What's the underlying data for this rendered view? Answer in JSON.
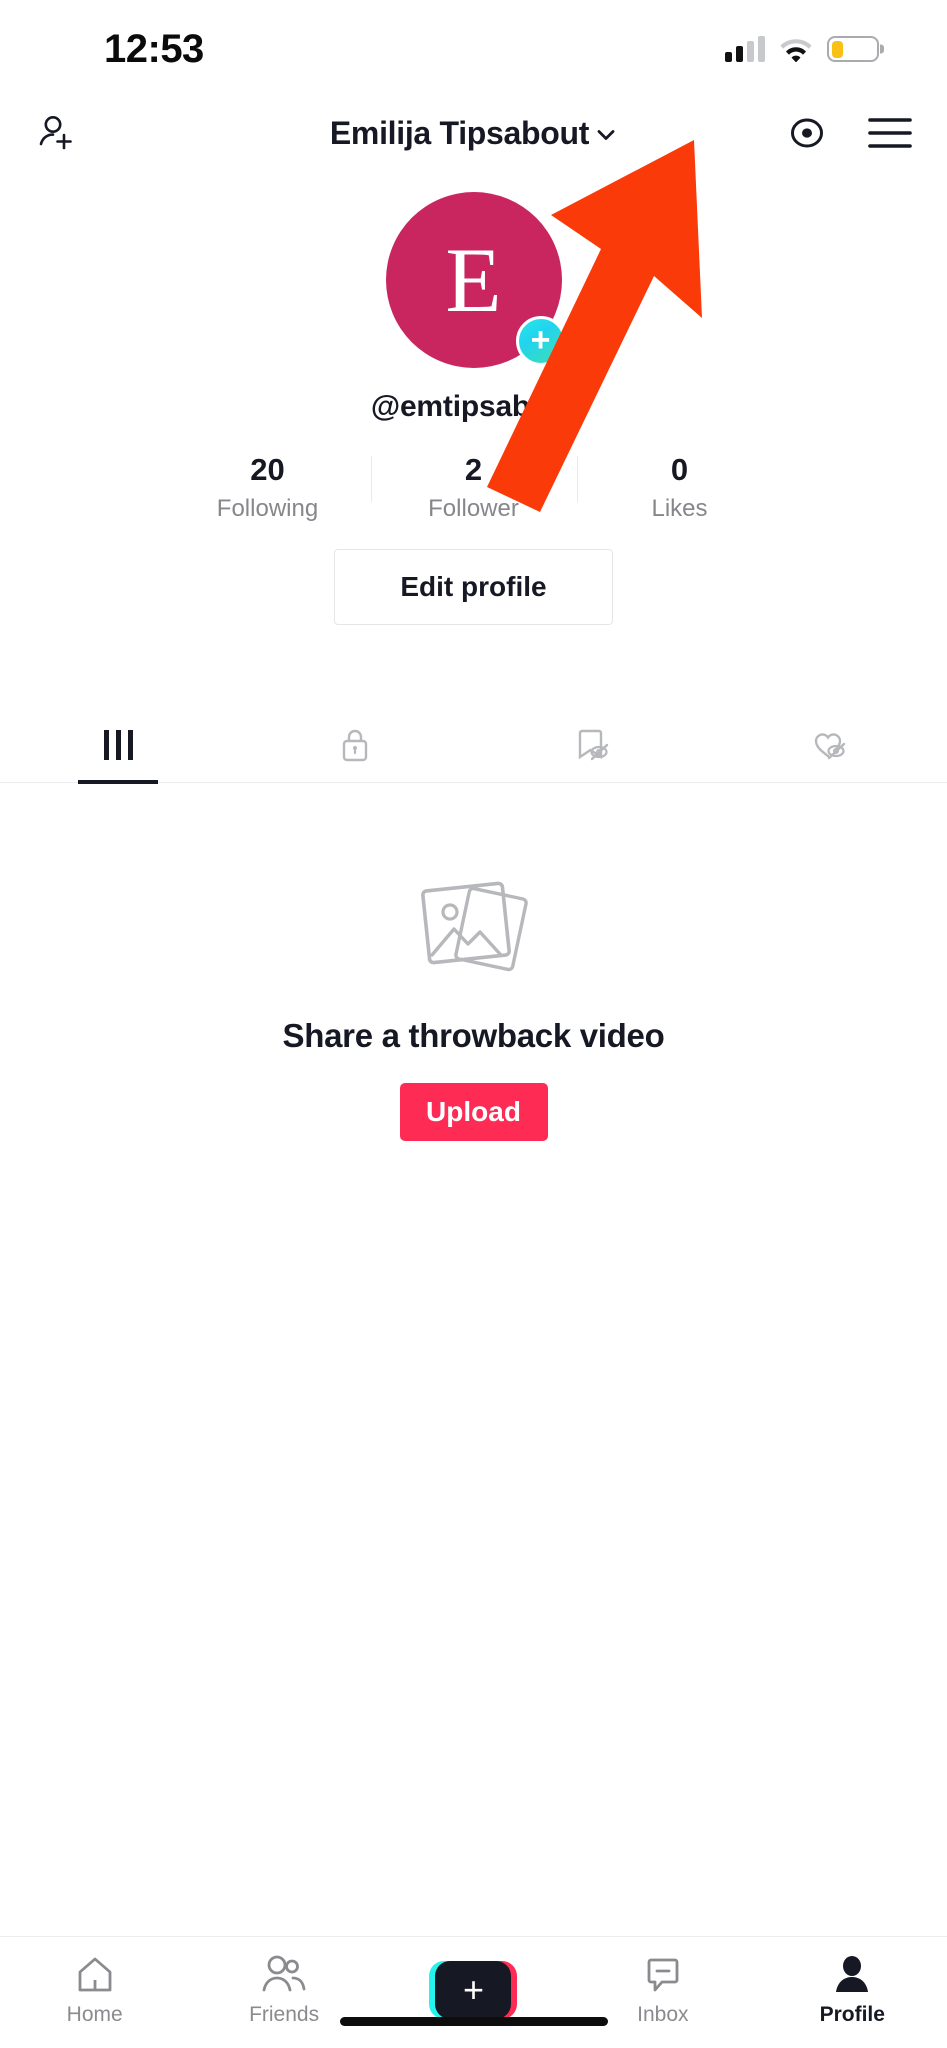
{
  "status_bar": {
    "time": "12:53",
    "signal_icon": "cellular-signal-icon",
    "wifi_icon": "wifi-icon",
    "battery_icon": "battery-low-icon",
    "battery_fill_color": "#f9c016"
  },
  "header": {
    "add_friend_icon": "add-person-icon",
    "title": "Emilija Tipsabout",
    "chevron_icon": "chevron-down-icon",
    "eye_icon": "profile-views-eye-icon",
    "menu_icon": "hamburger-menu-icon"
  },
  "profile": {
    "avatar_letter": "E",
    "avatar_color": "#c9255e",
    "avatar_badge_icon": "add-plus-badge-icon",
    "avatar_badge_color": "#25e8ea",
    "handle": "@emtipsabout",
    "stats": [
      {
        "value": "20",
        "label": "Following"
      },
      {
        "value": "2",
        "label": "Follower"
      },
      {
        "value": "0",
        "label": "Likes"
      }
    ],
    "edit_profile_label": "Edit profile"
  },
  "tabs": [
    {
      "name": "videos",
      "icon": "grid-posts-icon",
      "active": true
    },
    {
      "name": "private",
      "icon": "lock-icon",
      "active": false
    },
    {
      "name": "saved",
      "icon": "bookmark-hidden-icon",
      "active": false
    },
    {
      "name": "liked",
      "icon": "heart-hidden-icon",
      "active": false
    }
  ],
  "empty_state": {
    "icon": "photo-stack-icon",
    "title": "Share a throwback video",
    "upload_label": "Upload",
    "upload_color": "#fe2c55"
  },
  "bottom_nav": [
    {
      "label": "Home",
      "icon": "home-icon",
      "active": false
    },
    {
      "label": "Friends",
      "icon": "friends-icon",
      "active": false
    },
    {
      "label": "",
      "icon": "create-plus-icon",
      "active": false
    },
    {
      "label": "Inbox",
      "icon": "inbox-message-icon",
      "active": false
    },
    {
      "label": "Profile",
      "icon": "profile-person-icon",
      "active": true
    }
  ],
  "annotation": {
    "arrow_icon": "pointer-arrow-icon",
    "arrow_color": "#fb3a0a",
    "points_to": "hamburger-menu-icon"
  }
}
